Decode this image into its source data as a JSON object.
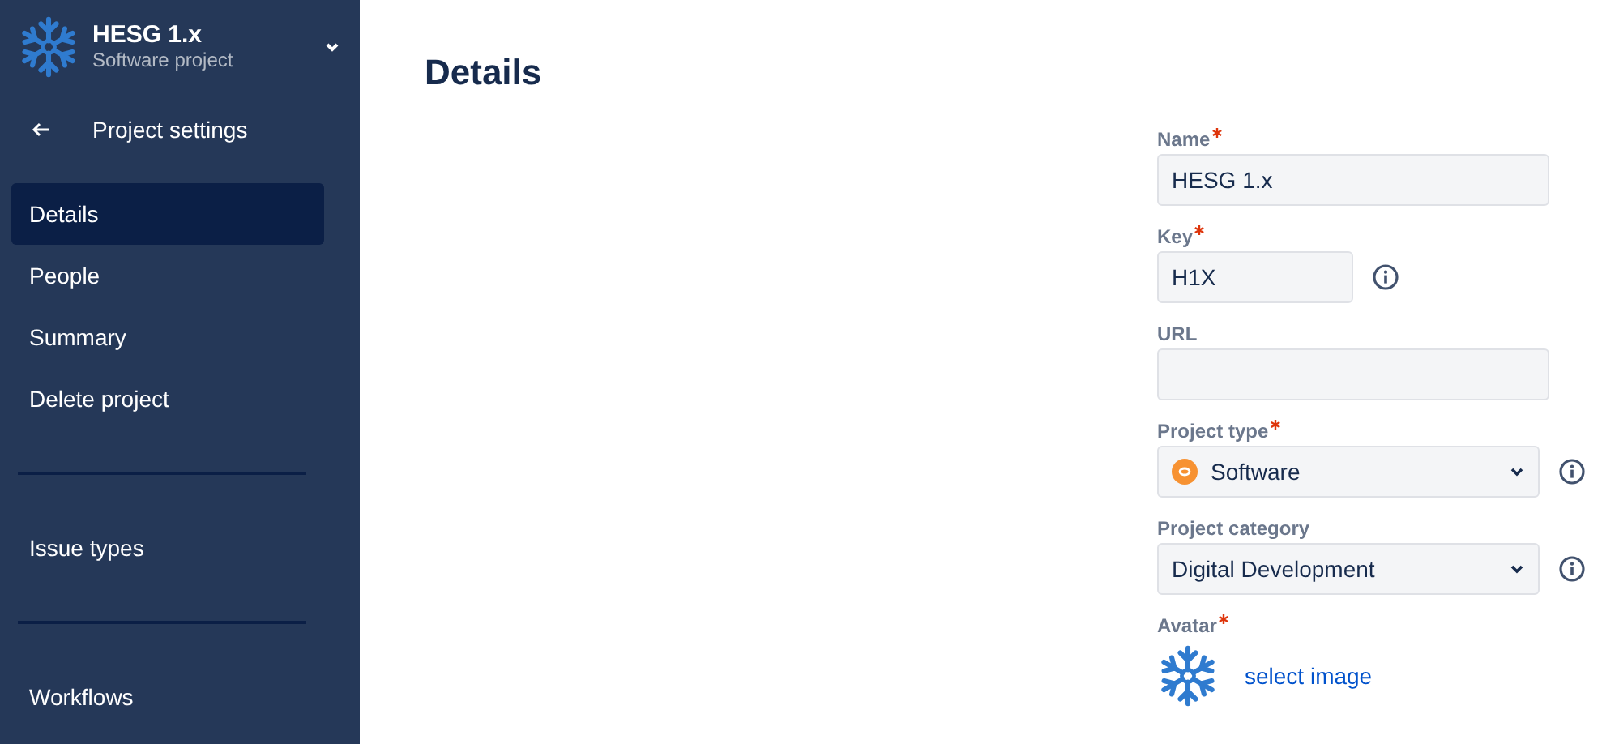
{
  "project": {
    "name": "HESG 1.x",
    "type": "Software project"
  },
  "back": {
    "label": "Project settings"
  },
  "sidebar": {
    "sections": [
      [
        {
          "label": "Details",
          "selected": true
        },
        {
          "label": "People",
          "selected": false
        },
        {
          "label": "Summary",
          "selected": false
        },
        {
          "label": "Delete project",
          "selected": false
        }
      ],
      [
        {
          "label": "Issue types",
          "selected": false
        }
      ],
      [
        {
          "label": "Workflows",
          "selected": false
        }
      ]
    ]
  },
  "page": {
    "title": "Details"
  },
  "fields": [
    {
      "kind": "text",
      "label": "Name",
      "required": true,
      "info": false,
      "value": "HESG 1.x",
      "short": false
    },
    {
      "kind": "text",
      "label": "Key",
      "required": true,
      "info": true,
      "value": "H1X",
      "short": true
    },
    {
      "kind": "text",
      "label": "URL",
      "required": false,
      "info": false,
      "short": false
    },
    {
      "kind": "select",
      "label": "Project type",
      "required": true,
      "info": true,
      "value": "Software",
      "typed": true
    },
    {
      "kind": "select",
      "label": "Project category",
      "required": false,
      "info": true,
      "value": "Digital Development",
      "typed": false
    },
    {
      "kind": "avatar",
      "label": "Avatar",
      "required": true,
      "info": false,
      "link": "select image"
    }
  ]
}
